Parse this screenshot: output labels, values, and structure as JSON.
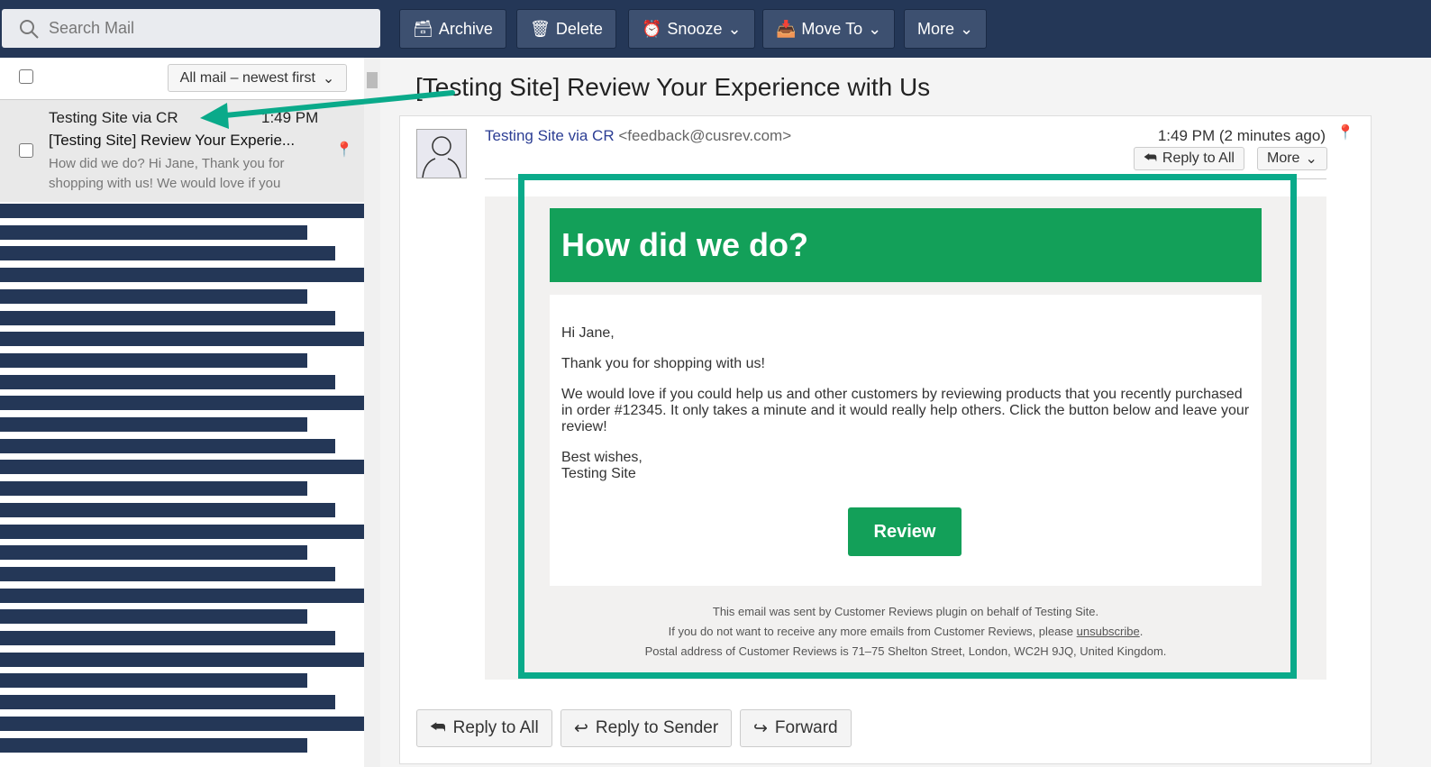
{
  "search": {
    "placeholder": "Search Mail"
  },
  "toolbar": {
    "archive": "Archive",
    "delete": "Delete",
    "snooze": "Snooze",
    "move_to": "Move To",
    "more": "More"
  },
  "list": {
    "sort": "All mail – newest first",
    "selected": {
      "from": "Testing Site via CR",
      "time": "1:49 PM",
      "subject": "[Testing Site] Review Your Experie...",
      "preview": "How did we do? Hi Jane, Thank you for shopping with us! We would love if you"
    }
  },
  "message": {
    "subject": "[Testing Site] Review Your Experience with Us",
    "from_name": "Testing Site via CR",
    "from_email": "<feedback@cusrev.com>",
    "time": "1:49 PM (2 minutes ago)",
    "reply_all": "Reply to All",
    "more": "More",
    "email": {
      "heading": "How did we do?",
      "greeting": "Hi Jane,",
      "p1": "Thank you for shopping with us!",
      "p2": "We would love if you could help us and other customers by reviewing products that you recently purchased in order #12345. It only takes a minute and it would really help others. Click the button below and leave your review!",
      "sign1": "Best wishes,",
      "sign2": "Testing Site",
      "button": "Review",
      "footer1": "This email was sent by Customer Reviews plugin on behalf of Testing Site.",
      "footer2a": "If you do not want to receive any more emails from Customer Reviews, please ",
      "footer2link": "unsubscribe",
      "footer2b": ".",
      "footer3": "Postal address of Customer Reviews is 71–75 Shelton Street, London, WC2H 9JQ, United Kingdom."
    }
  },
  "actions": {
    "reply_all": "Reply to All",
    "reply_sender": "Reply to Sender",
    "forward": "Forward"
  },
  "colors": {
    "topbar": "#243757",
    "green": "#13a059",
    "annotation": "#0aaa8a",
    "link": "#2c3e94"
  }
}
